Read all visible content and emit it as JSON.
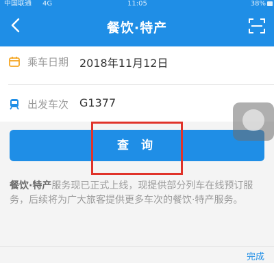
{
  "status_bar": {
    "carrier": "中国联通",
    "network": "4G",
    "time": "11:05",
    "battery": "38%"
  },
  "header": {
    "title": "餐饮·特产",
    "back_icon": "chevron-left-icon",
    "scan_icon": "scan-icon"
  },
  "form": {
    "date": {
      "label": "乘车日期",
      "value": "2018年11月12日"
    },
    "train": {
      "label": "出发车次",
      "value": "G1377"
    }
  },
  "query_button": {
    "label": "查 询"
  },
  "notice": {
    "title": "餐饮·特产",
    "text": "服务现已正式上线，现提供部分列车在线预订服务，后续将为广大旅客提供更多车次的餐饮·特产服务。"
  },
  "bottom": {
    "done_label": "完成"
  },
  "colors": {
    "primary": "#1f8ee6",
    "highlight": "#e0332a",
    "accent_icon": "#f5a623"
  }
}
